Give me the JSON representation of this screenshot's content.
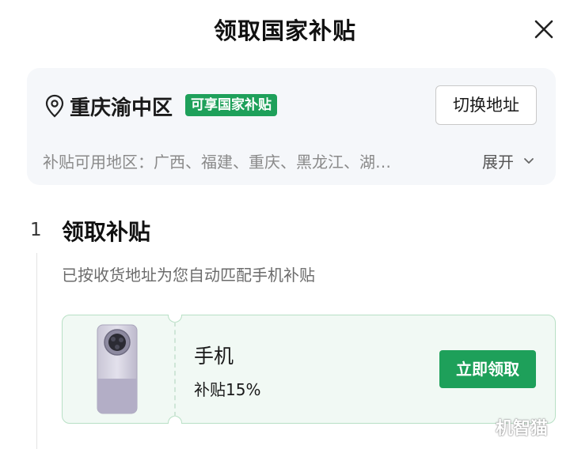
{
  "header": {
    "title": "领取国家补贴",
    "close_icon": "close-icon"
  },
  "address": {
    "location_icon": "location-pin-icon",
    "city": "重庆渝中区",
    "badge": "可享国家补贴",
    "switch_label": "切换地址",
    "regions_text": "补贴可用地区：广西、福建、重庆、黑龙江、湖…",
    "expand_label": "展开",
    "expand_icon": "chevron-down-icon"
  },
  "step": {
    "number": "1",
    "title": "领取补贴",
    "description": "已按收货地址为您自动匹配手机补贴"
  },
  "coupon": {
    "product_image": "phone-image",
    "product_name": "手机",
    "subsidy": "补贴15%",
    "claim_label": "立即领取"
  },
  "colors": {
    "accent_green": "#1ea05a",
    "card_bg": "#f5f7fa",
    "coupon_bg": "#f1f9f4"
  },
  "watermark": "机智猫"
}
